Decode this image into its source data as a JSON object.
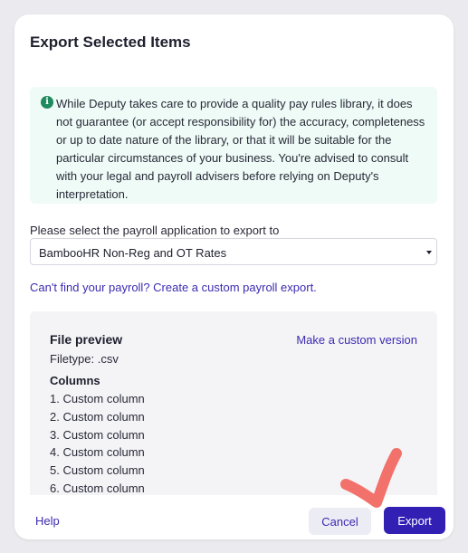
{
  "dialog": {
    "title": "Export Selected Items"
  },
  "notice": {
    "icon": "info-icon",
    "text": "While Deputy takes care to provide a quality pay rules library, it does not guarantee (or accept responsibility for) the accuracy, completeness or up to date nature of the library, or that it will be suitable for the particular circumstances of your business. You're advised to consult with your legal and payroll advisers before relying on Deputy's interpretation."
  },
  "payroll": {
    "label": "Please select the payroll application to export to",
    "selected": "BambooHR Non-Reg and OT Rates",
    "custom_link": "Can't find your payroll? Create a custom payroll export."
  },
  "preview": {
    "title": "File preview",
    "make_custom": "Make a custom version",
    "filetype": "Filetype: .csv",
    "columns_title": "Columns",
    "columns": [
      "1. Custom column",
      "2. Custom column",
      "3. Custom column",
      "4. Custom column",
      "5. Custom column",
      "6. Custom column"
    ]
  },
  "footer": {
    "help": "Help",
    "cancel": "Cancel",
    "export": "Export"
  },
  "colors": {
    "primary": "#3220b5",
    "link": "#3b2bb0",
    "notice_bg": "#eefbf6",
    "annotation": "#f2716b"
  }
}
